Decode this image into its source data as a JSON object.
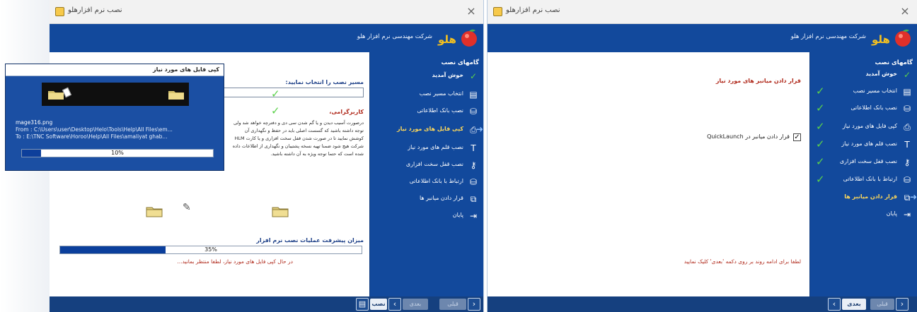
{
  "window1": {
    "title": "نصب نرم افزارهلو",
    "close_glyph": "×",
    "banner_text": "شرکت مهندسی نرم افزار هلو",
    "logo_text": "هلو",
    "steps_title": "گامهای نصب",
    "steps": [
      {
        "label": "خوش آمدید",
        "icon": "✓"
      },
      {
        "label": "انتخاب مسیر نصب",
        "icon": "▤"
      },
      {
        "label": "نصب بانک اطلاعاتی",
        "icon": "⛁"
      },
      {
        "label": "کپی فایل های مورد نیاز",
        "icon": "⎙"
      },
      {
        "label": "نصب قلم های مورد نیاز",
        "icon": "T"
      },
      {
        "label": "نصب قفل سخت افزاری",
        "icon": "⚷"
      },
      {
        "label": "ارتباط با بانک اطلاعاتی",
        "icon": "⛁"
      },
      {
        "label": "قرار دادن میانبر ها",
        "icon": "⧉"
      },
      {
        "label": "پایان",
        "icon": "⇥"
      }
    ],
    "path_label": "مسیر نصب را انتخاب نمایید:",
    "user_heading": "کاربرگرامی،",
    "notice_text": "درصورت آسیب دیدن و یا گم شدن سی دی و دفترچه خواهد شد ولی توجه داشته باشید که گسست اصلی باید در حفظ و نگهداری آن کوشش نمایید تا در صورت شدن قفل سخت افزاری و یا کارت HLM شرکت هیچ شود ضمنا تهیه نسخه پشتیبان و نگهداری از اطلاعات داده شده است که حتما توجه ویژه به آن داشته باشید.",
    "progress_label": "میزان پیشرفت عملیات نصب نرم افزار",
    "progress_percent": 35,
    "progress_text": "35%",
    "status_line": "در حال کپی فایل های مورد نیاز، لطفا منتظر بمانید...",
    "footer": {
      "prev_label": "قبلی",
      "next_label": "بعدی",
      "install_label": "نصب",
      "prev_chevron": "›",
      "next_chevron": "‹",
      "install_icon": "▤"
    }
  },
  "copy_dialog": {
    "title": "کپی فایل های مورد نیاز",
    "file": "mage316.png",
    "from": "From : C:\\Users\\user\\Desktop\\Helo\\Tools\\Help\\All Files\\em...",
    "to": "To : E:\\TNC Software\\Horoo\\Help\\All Files\\amaliyat ghab...",
    "progress_percent": 10,
    "progress_text": "10%"
  },
  "window2": {
    "title": "نصب نرم افزارهلو",
    "close_glyph": "×",
    "banner_text": "شرکت مهندسی نرم افزار هلو",
    "logo_text": "هلو",
    "steps_title": "گامهای نصب",
    "steps": [
      {
        "label": "خوش آمدید",
        "icon": "✓"
      },
      {
        "label": "انتخاب مسیر نصب",
        "icon": "▤"
      },
      {
        "label": "نصب بانک اطلاعاتی",
        "icon": "⛁"
      },
      {
        "label": "کپی فایل های مورد نیاز",
        "icon": "⎙"
      },
      {
        "label": "نصب قلم های مورد نیاز",
        "icon": "T"
      },
      {
        "label": "نصب قفل سخت افزاری",
        "icon": "⚷"
      },
      {
        "label": "ارتباط با بانک اطلاعاتی",
        "icon": "⛁"
      },
      {
        "label": "قرار دادن میانبر ها",
        "icon": "⧉"
      },
      {
        "label": "پایان",
        "icon": "⇥"
      }
    ],
    "heading": "قرار دادن میانبر های مورد نیاز",
    "checkbox_label": "قرار دادن میانبر در QuickLaunch",
    "checkbox_checked": true,
    "checkbox_mark": "✓",
    "note": "لطفا برای ادامه روند بر روی دکمه 'بعدی' کلیک نمایید",
    "footer": {
      "prev_label": "قبلی",
      "next_label": "بعدی",
      "prev_chevron": "›",
      "next_chevron": "‹"
    }
  },
  "colors": {
    "banner": "#12499c",
    "sidebar": "#12499c",
    "check": "#5bd14a",
    "active_step": "#ffd95a",
    "accent_red": "#b0291b",
    "progress_fill": "#0b3f9c"
  },
  "icons": {
    "logo": "peach-logo-icon",
    "step_done": "check-icon",
    "step_active": "arrow-right-icon",
    "folder": "folder-icon"
  }
}
